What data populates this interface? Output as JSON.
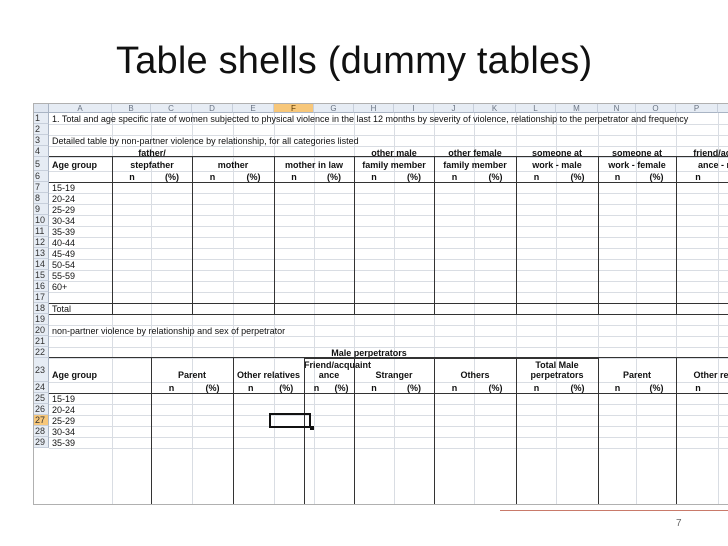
{
  "slide": {
    "title": "Table shells (dummy tables)",
    "page_number": "7"
  },
  "sheet": {
    "columns": [
      "A",
      "B",
      "C",
      "D",
      "E",
      "F",
      "G",
      "H",
      "I",
      "J",
      "K",
      "L",
      "M",
      "N",
      "O",
      "P",
      "Q"
    ],
    "selected_column": "F",
    "rows": [
      "1",
      "2",
      "3",
      "4",
      "5",
      "6",
      "7",
      "8",
      "9",
      "10",
      "11",
      "12",
      "13",
      "14",
      "15",
      "16",
      "17",
      "18",
      "19",
      "20",
      "21",
      "22",
      "23",
      "24",
      "25",
      "26",
      "27",
      "28",
      "29"
    ],
    "selected_row": "27",
    "row1_text": "1. Total and age specific rate of women subjected to physical violence in the last 12 months by severity of violence, relationship to the perpetrator and frequency",
    "row3_text": "Detailed table by non-partner violence by relationship, for all categories listed",
    "table1": {
      "age_group_label": "Age group",
      "headers": [
        [
          "father/",
          "stepfather"
        ],
        [
          "mother"
        ],
        [
          "mother in law"
        ],
        [
          "other male",
          "family member"
        ],
        [
          "other female",
          "family member"
        ],
        [
          "someone at",
          "work - male"
        ],
        [
          "someone at",
          "work - female"
        ],
        [
          "friend/acqua",
          "ance - mal"
        ]
      ],
      "n_label": "n",
      "pct_label": "(%)",
      "age_groups": [
        "15-19",
        "20-24",
        "25-29",
        "30-34",
        "35-39",
        "40-44",
        "45-49",
        "50-54",
        "55-59",
        "60+"
      ],
      "total_label": "Total"
    },
    "row20_text": "non-partner violence by relationship and sex of perpetrator",
    "table2": {
      "group_header": "Male perpetrators",
      "age_group_label": "Age group",
      "headers": [
        [
          "Parent"
        ],
        [
          "Other relatives"
        ],
        [
          "Friend/acquaint",
          "ance"
        ],
        [
          "Stranger"
        ],
        [
          "Others"
        ],
        [
          "Total Male",
          "perpetrators"
        ],
        [
          "Parent"
        ],
        [
          "Other relativ"
        ]
      ],
      "age_groups": [
        "15-19",
        "20-24",
        "25-29",
        "30-34",
        "35-39"
      ]
    }
  }
}
